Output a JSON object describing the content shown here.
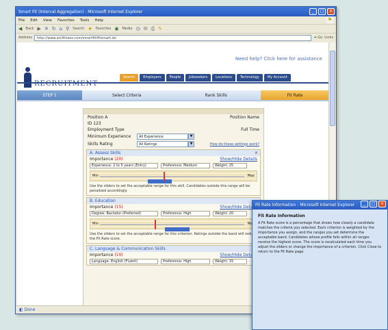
{
  "window": {
    "title": "Smart Fit (Interval Aggregation) - Microsoft Internet Explorer",
    "menu": [
      "File",
      "Edit",
      "View",
      "Favorites",
      "Tools",
      "Help"
    ],
    "toolbar": [
      "Back",
      "Search",
      "Favorites",
      "Media"
    ],
    "address_label": "Address",
    "address_value": "http://www.arcfitness.com/smartfit/fitsmart.do",
    "go_label": "Go",
    "links_label": "Links",
    "status_text": "Done"
  },
  "site": {
    "tagline": "Need help? Click here for assistance",
    "brand_name": "RECRUITMENT",
    "nav": [
      "Search",
      "Employers",
      "People",
      "Jobseekers",
      "Locations",
      "Technology",
      "My Account"
    ],
    "active_nav_index": 0
  },
  "steps": [
    "STEP 1",
    "Select Criteria",
    "Rank Skills",
    "Fit Rate"
  ],
  "form": {
    "top_left": "Position A",
    "top_right": "Position Name",
    "row2_left": "ID 123",
    "row3_left": "Employment Type",
    "row3_right": "Full Time",
    "field1_label": "Minimum Experience",
    "field1_value": "All Experience",
    "field2_label": "Skills Rating",
    "field2_value": "All Ratings",
    "help_link": "How do these settings work?"
  },
  "sections": [
    {
      "title": "A. Assess Skills",
      "importance_label": "Importance",
      "importance_value": "(20)",
      "link": "Show/Hide Details",
      "fields": [
        "Experience: 2 to 5 years (Entry)",
        "Preference: Medium",
        "Weight: 25"
      ],
      "low": "Min",
      "high": "Max",
      "range_start": 0.33,
      "range_end": 0.5,
      "marker": 0.44,
      "desc": "Use the sliders to set the acceptable range for this skill. Candidates outside this range will be penalized accordingly."
    },
    {
      "title": "B. Education",
      "importance_label": "Importance",
      "importance_value": "(15)",
      "link": "Show/Hide Details",
      "fields": [
        "Degree: Bachelor (Preferred)",
        "Preference: High",
        "Weight: 20"
      ],
      "low": "Min",
      "high": "Max",
      "range_start": 0.45,
      "range_end": 0.62,
      "marker": 0.38,
      "desc": "Use the sliders to set the acceptable range for this criterion. Ratings outside the band will reduce the Fit Rate score."
    },
    {
      "title": "C. Language & Communication Skills",
      "importance_label": "Importance",
      "importance_value": "(10)",
      "link": "Show/Hide Details",
      "fields": [
        "Language: English (Fluent)",
        "Preference: High",
        "Weight: 15"
      ]
    }
  ],
  "popup": {
    "title": "Fit Rate Information - Microsoft Internet Explorer",
    "heading": "Fit Rate Information",
    "body": "A Fit Rate score is a percentage that shows how closely a candidate matches the criteria you selected. Each criterion is weighted by the importance you assign, and the ranges you set determine the acceptable band. Candidates whose profile falls within all ranges receive the highest score. The score is recalculated each time you adjust the sliders or change the importance of a criterion. Click Close to return to the Fit Rate page."
  }
}
